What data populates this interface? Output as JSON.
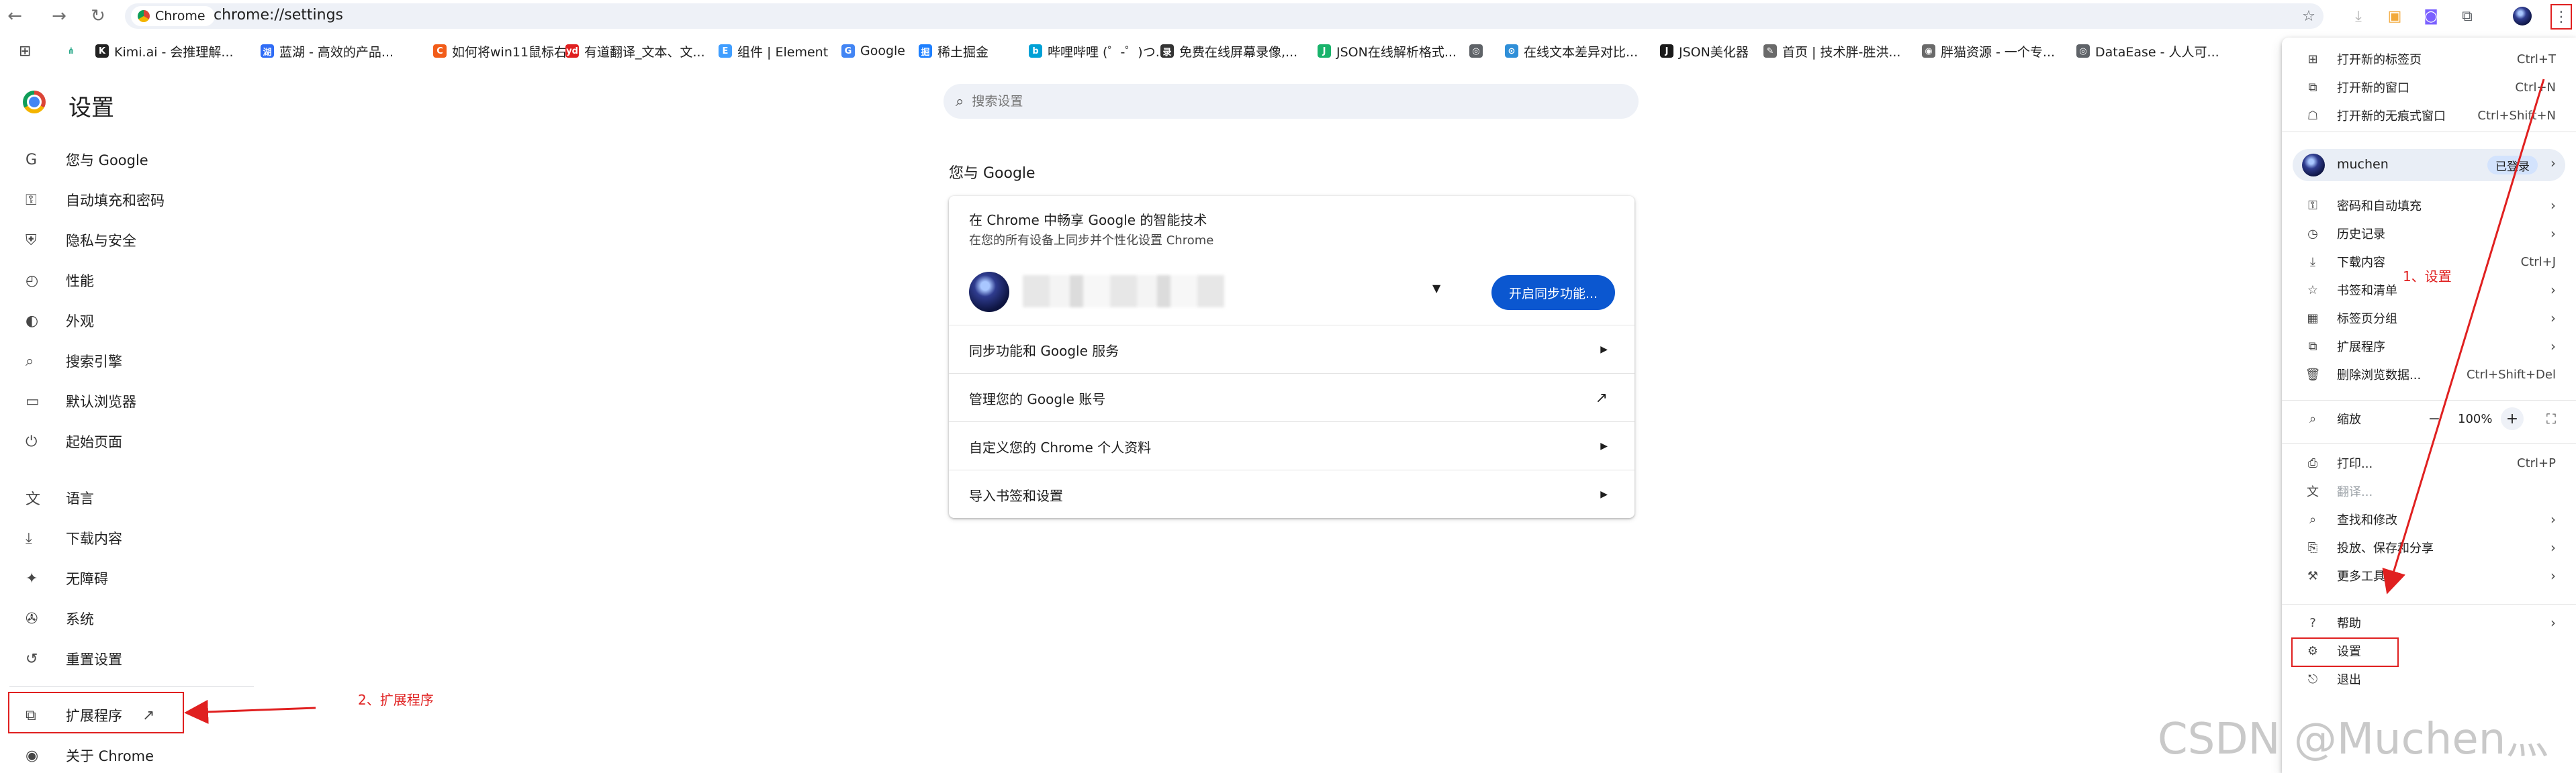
{
  "browser": {
    "nav": {
      "back": "←",
      "forward": "→",
      "reload": "↻"
    },
    "chip_label": "Chrome",
    "url": "chrome://settings"
  },
  "bookmarks": [
    {
      "label": "Kimi.ai - 会推理解...",
      "color": "#222222",
      "glyph": "K"
    },
    {
      "label": "蓝湖 - 高效的产品...",
      "color": "#2f6cf6",
      "glyph": "湖"
    },
    {
      "label": "如何将win11鼠标右...",
      "color": "#f25c19",
      "glyph": "C"
    },
    {
      "label": "有道翻译_文本、文...",
      "color": "#e02020",
      "glyph": "yd"
    },
    {
      "label": "组件 | Element",
      "color": "#409eff",
      "glyph": "E"
    },
    {
      "label": "Google",
      "color": "#4285f4",
      "glyph": "G"
    },
    {
      "label": "稀土掘金",
      "color": "#1e80ff",
      "glyph": "掘"
    },
    {
      "label": "哔哩哔哩 (゜-゜)つ...",
      "color": "#00a1d6",
      "glyph": "b"
    },
    {
      "label": "免费在线屏幕录像,...",
      "color": "#333333",
      "glyph": "录"
    },
    {
      "label": "JSON在线解析格式...",
      "color": "#19b36b",
      "glyph": "J"
    },
    {
      "label": "",
      "color": "#5f6368",
      "glyph": "◎"
    },
    {
      "label": "在线文本差异对比...",
      "color": "#2f8fd8",
      "glyph": "⊙"
    },
    {
      "label": "JSON美化器",
      "color": "#1a1a1a",
      "glyph": "J"
    },
    {
      "label": "首页 | 技术胖-胜洪...",
      "color": "#6a6a6a",
      "glyph": "✎"
    },
    {
      "label": "胖猫资源 - 一个专...",
      "color": "#6a6a6a",
      "glyph": "◉"
    },
    {
      "label": "DataEase - 人人可...",
      "color": "#5f6368",
      "glyph": "◎"
    }
  ],
  "sidebar": {
    "title": "设置",
    "items": [
      {
        "label": "您与 Google",
        "icon": "G"
      },
      {
        "label": "自动填充和密码",
        "icon": "⚿"
      },
      {
        "label": "隐私与安全",
        "icon": "⛨"
      },
      {
        "label": "性能",
        "icon": "◴"
      },
      {
        "label": "外观",
        "icon": "◐"
      },
      {
        "label": "搜索引擎",
        "icon": "⌕"
      },
      {
        "label": "默认浏览器",
        "icon": "▭"
      },
      {
        "label": "起始页面",
        "icon": "⏻"
      },
      {
        "label": "语言",
        "icon": "文"
      },
      {
        "label": "下载内容",
        "icon": "⤓"
      },
      {
        "label": "无障碍",
        "icon": "✦"
      },
      {
        "label": "系统",
        "icon": "✇"
      },
      {
        "label": "重置设置",
        "icon": "↺"
      },
      {
        "label": "扩展程序",
        "icon": "⧉"
      },
      {
        "label": "关于 Chrome",
        "icon": "◉"
      }
    ],
    "extensions_external_icon": "↗"
  },
  "search": {
    "placeholder": "搜索设置"
  },
  "main": {
    "section_title": "您与 Google",
    "sync_title": "在 Chrome 中畅享 Google 的智能技术",
    "sync_subtitle": "在您的所有设备上同步并个性化设置 Chrome",
    "sync_button": "开启同步功能...",
    "dropdown": "▼",
    "rows": [
      {
        "label": "同步功能和 Google 服务",
        "trail": "▶"
      },
      {
        "label": "管理您的 Google 账号",
        "trail": "↗"
      },
      {
        "label": "自定义您的 Chrome 个人资料",
        "trail": "▶"
      },
      {
        "label": "导入书签和设置",
        "trail": "▶"
      }
    ]
  },
  "menu": {
    "group1": [
      {
        "label": "打开新的标签页",
        "shortcut": "Ctrl+T",
        "icon": "⊞"
      },
      {
        "label": "打开新的窗口",
        "shortcut": "Ctrl+N",
        "icon": "⧉"
      },
      {
        "label": "打开新的无痕式窗口",
        "shortcut": "Ctrl+Shift+N",
        "icon": "☖"
      }
    ],
    "profile": {
      "name": "muchen",
      "status": "已登录",
      "chevron": "›"
    },
    "group2": [
      {
        "label": "密码和自动填充",
        "icon": "⚿",
        "chev": "›"
      },
      {
        "label": "历史记录",
        "icon": "◷",
        "chev": "›"
      },
      {
        "label": "下载内容",
        "icon": "⤓",
        "shortcut": "Ctrl+J"
      },
      {
        "label": "书签和清单",
        "icon": "☆",
        "chev": "›"
      },
      {
        "label": "标签页分组",
        "icon": "▦",
        "chev": "›"
      },
      {
        "label": "扩展程序",
        "icon": "⧉",
        "chev": "›"
      },
      {
        "label": "删除浏览数据...",
        "icon": "🗑",
        "shortcut": "Ctrl+Shift+Del"
      }
    ],
    "zoom": {
      "label": "缩放",
      "icon": "⌕",
      "minus": "−",
      "value": "100%",
      "plus": "+",
      "fullscreen": "⛶"
    },
    "group3": [
      {
        "label": "打印...",
        "icon": "⎙",
        "shortcut": "Ctrl+P"
      },
      {
        "label": "翻译...",
        "icon": "文",
        "dim": true
      },
      {
        "label": "查找和修改",
        "icon": "⌕",
        "chev": "›"
      },
      {
        "label": "投放、保存和分享",
        "icon": "⎘",
        "chev": "›"
      },
      {
        "label": "更多工具",
        "icon": "⚒",
        "chev": "›"
      }
    ],
    "group4": [
      {
        "label": "帮助",
        "icon": "?",
        "chev": "›"
      },
      {
        "label": "设置",
        "icon": "⚙"
      },
      {
        "label": "退出",
        "icon": "⎋"
      }
    ]
  },
  "annotations": {
    "step1": "1、设置",
    "step2": "2、扩展程序",
    "watermark": "CSDN @Muchen灬"
  },
  "colors": {
    "accent": "#0b57d0",
    "annotation": "#e02020"
  }
}
